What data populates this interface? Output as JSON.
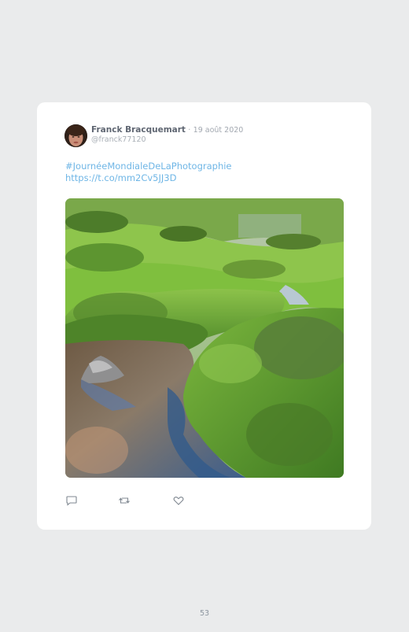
{
  "tweet": {
    "author_name": "Franck Bracquemart",
    "separator": "·",
    "date": "19 août 2020",
    "handle": "@franck77120",
    "hashtag": "#JournéeMondialeDeLaPhotographie",
    "link": "https://t.co/mm2Cv5JJ3D",
    "avatar_icon": "user-avatar-photo",
    "photo_description_icon": "landscape-photo"
  },
  "actions": [
    {
      "icon": "reply-icon"
    },
    {
      "icon": "retweet-icon"
    },
    {
      "icon": "like-icon"
    }
  ],
  "colors": {
    "background": "#eaebec",
    "card": "#ffffff",
    "link": "#6fb6e6",
    "name": "#5f6672",
    "muted": "#a2a8b0"
  },
  "footer": {
    "page_number": "53"
  }
}
